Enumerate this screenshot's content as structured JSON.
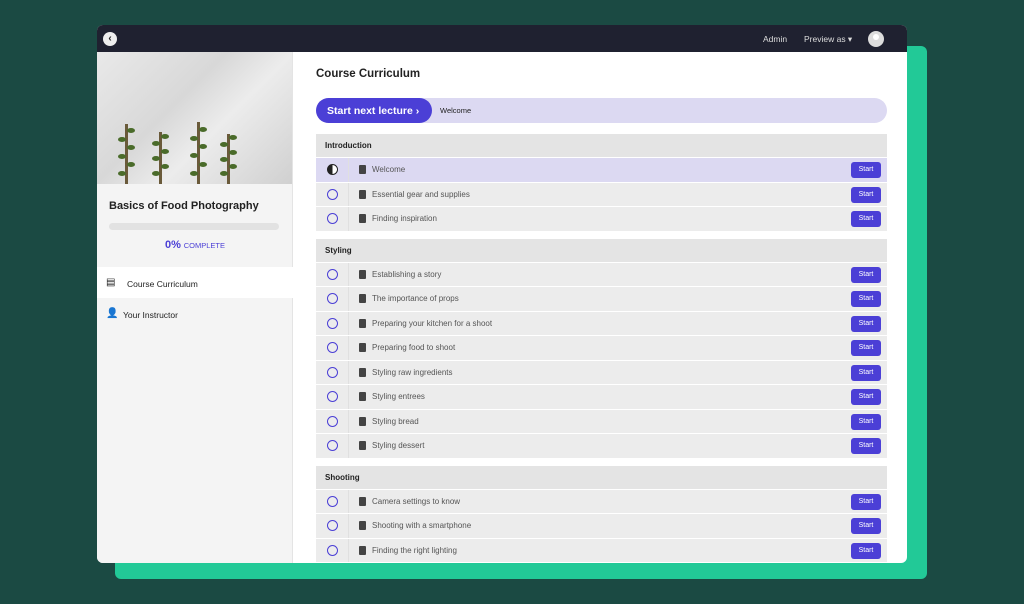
{
  "topbar": {
    "admin": "Admin",
    "preview": "Preview as ▾"
  },
  "course": {
    "title": "Basics of Food Photography",
    "progress_percent": 0,
    "percent_label": "0%",
    "complete_label": "COMPLETE"
  },
  "nav": [
    {
      "label": "Course Curriculum",
      "icon": "curriculum-icon",
      "active": true
    },
    {
      "label": "Your Instructor",
      "icon": "user-icon",
      "active": false
    }
  ],
  "main": {
    "title": "Course Curriculum",
    "start_next": "Start next lecture  ›",
    "next_lecture": "Welcome",
    "start_label": "Start"
  },
  "sections": [
    {
      "title": "Introduction",
      "lectures": [
        "Welcome",
        "Essential gear and supplies",
        "Finding inspiration"
      ]
    },
    {
      "title": "Styling",
      "lectures": [
        "Establishing a story",
        "The importance of props",
        "Preparing your kitchen for a shoot",
        "Preparing food to shoot",
        "Styling raw ingredients",
        "Styling entrees",
        "Styling bread",
        "Styling dessert"
      ]
    },
    {
      "title": "Shooting",
      "lectures": [
        "Camera settings to know",
        "Shooting with a smartphone",
        "Finding the right lighting"
      ]
    }
  ],
  "colors": {
    "accent": "#4b3fd6",
    "background": "#1b4a43",
    "green": "#22c997"
  }
}
